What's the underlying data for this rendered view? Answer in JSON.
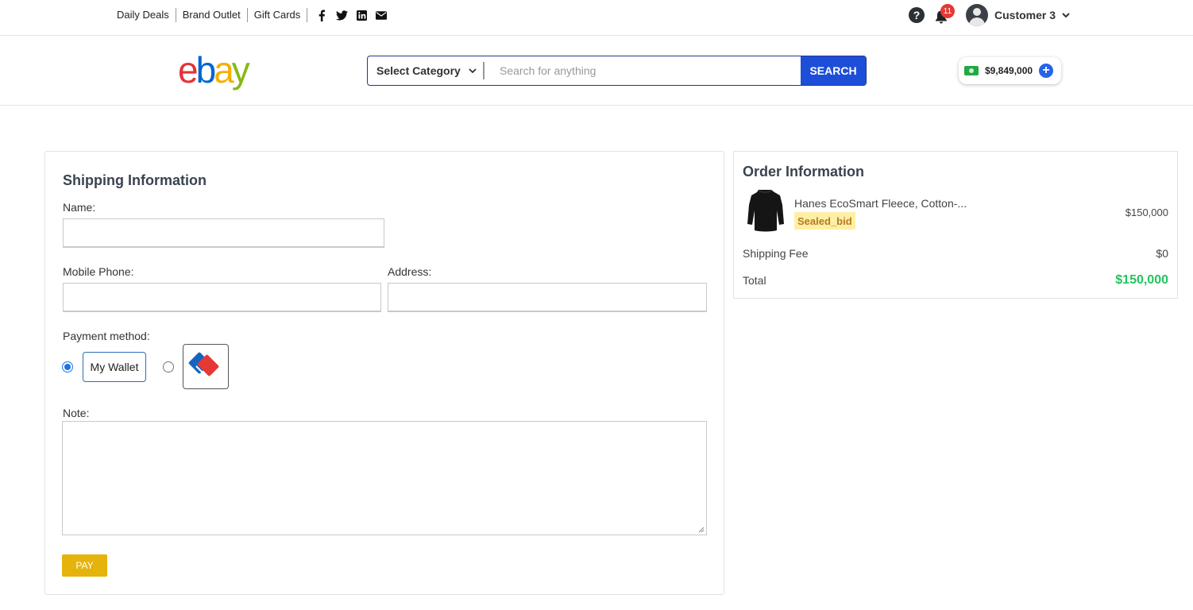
{
  "topbar": {
    "links": [
      "Daily Deals",
      "Brand Outlet",
      "Gift Cards"
    ],
    "social_icons": [
      "facebook-icon",
      "twitter-icon",
      "linkedin-icon",
      "email-icon"
    ],
    "notification_count": "11",
    "user_name": "Customer 3"
  },
  "header": {
    "logo_letters": [
      "e",
      "b",
      "a",
      "y"
    ],
    "logo_colors": [
      "#e53238",
      "#0064d2",
      "#f5af02",
      "#86b817"
    ],
    "category_label": "Select Category",
    "search_placeholder": "Search for anything",
    "search_button": "SEARCH",
    "wallet_balance": "$9,849,000"
  },
  "shipping": {
    "title": "Shipping Information",
    "name_label": "Name:",
    "phone_label": "Mobile Phone:",
    "address_label": "Address:",
    "payment_label": "Payment method:",
    "wallet_option": "My Wallet",
    "card_option_icon": "bank-card-icon",
    "note_label": "Note:",
    "pay_button": "PAY"
  },
  "order": {
    "title": "Order Information",
    "product_name": "Hanes EcoSmart Fleece, Cotton-...",
    "product_tag": "Sealed_bid",
    "product_price": "$150,000",
    "shipping_label": "Shipping Fee",
    "shipping_value": "$0",
    "total_label": "Total",
    "total_value": "$150,000"
  },
  "colors": {
    "accent_blue": "#1d4ed8",
    "pay_yellow": "#e6b30b",
    "total_green": "#22c55e"
  }
}
